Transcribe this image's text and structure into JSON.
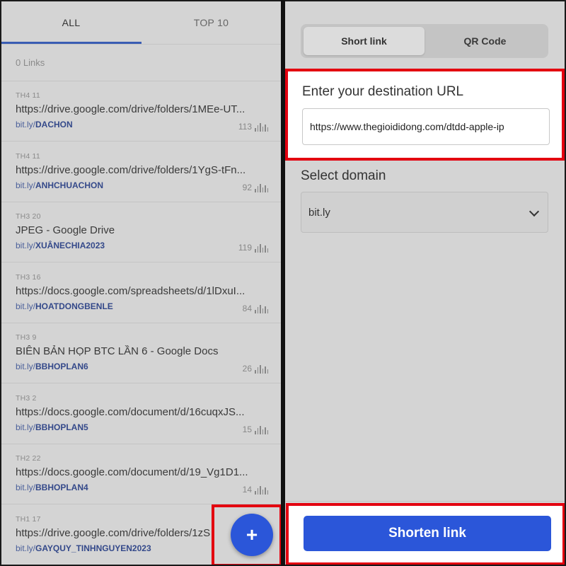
{
  "left": {
    "tabs": [
      {
        "label": "ALL"
      },
      {
        "label": "TOP 10"
      }
    ],
    "links_count": "0 Links",
    "items": [
      {
        "date": "TH4 11",
        "title": "https://drive.google.com/drive/folders/1MEe-UT...",
        "prefix": "bit.ly/",
        "slug": "DACHON",
        "clicks": "113"
      },
      {
        "date": "TH4 11",
        "title": "https://drive.google.com/drive/folders/1YgS-tFn...",
        "prefix": "bit.ly/",
        "slug": "ANHCHUACHON",
        "clicks": "92"
      },
      {
        "date": "TH3 20",
        "title": "JPEG - Google Drive",
        "prefix": "bit.ly/",
        "slug": "XUÂNECHIA2023",
        "clicks": "119"
      },
      {
        "date": "TH3 16",
        "title": "https://docs.google.com/spreadsheets/d/1lDxuI...",
        "prefix": "bit.ly/",
        "slug": "HOATDONGBENLE",
        "clicks": "84"
      },
      {
        "date": "TH3 9",
        "title": "BIÊN BẢN HỌP BTC LẦN 6 - Google Docs",
        "prefix": "bit.ly/",
        "slug": "BBHOPLAN6",
        "clicks": "26"
      },
      {
        "date": "TH3 2",
        "title": "https://docs.google.com/document/d/16cuqxJS...",
        "prefix": "bit.ly/",
        "slug": "BBHOPLAN5",
        "clicks": "15"
      },
      {
        "date": "TH2 22",
        "title": "https://docs.google.com/document/d/19_Vg1D1...",
        "prefix": "bit.ly/",
        "slug": "BBHOPLAN4",
        "clicks": "14"
      },
      {
        "date": "TH1 17",
        "title": "https://drive.google.com/drive/folders/1zS",
        "prefix": "bit.ly/",
        "slug": "GAYQUY_TINHNGUYEN2023",
        "clicks": ""
      }
    ],
    "fab_label": "+"
  },
  "right": {
    "segments": [
      {
        "label": "Short link"
      },
      {
        "label": "QR Code"
      }
    ],
    "url_label": "Enter your destination URL",
    "url_value": "https://www.thegioididong.com/dtdd-apple-ip",
    "domain_label": "Select domain",
    "domain_value": "bit.ly",
    "shorten_label": "Shorten link"
  },
  "colors": {
    "accent": "#2b56d9",
    "highlight_box": "#e3000f",
    "tab_underline": "#3a5db3",
    "link_slug": "#34498a"
  }
}
